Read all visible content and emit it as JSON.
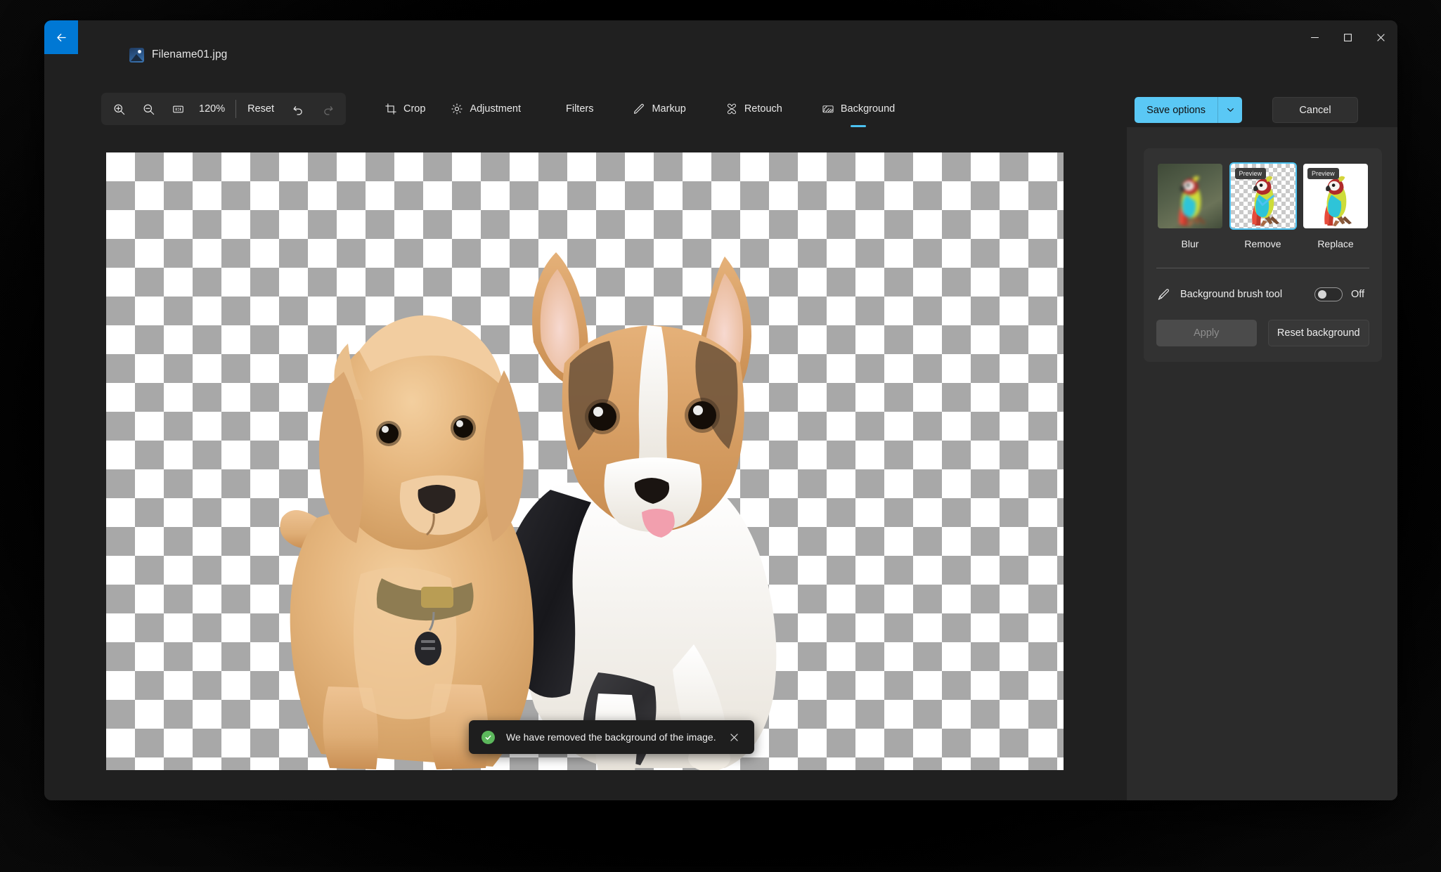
{
  "window": {
    "file_name": "Filename01.jpg",
    "back_icon": "arrow-left-icon",
    "file_icon": "photo-icon",
    "controls": {
      "minimize": "minimize-icon",
      "maximize": "maximize-icon",
      "close": "close-icon"
    }
  },
  "toolbar": {
    "zoom_in_icon": "zoom-in-icon",
    "zoom_out_icon": "zoom-out-icon",
    "actual_size_icon": "one-to-one-icon",
    "zoom_level": "120%",
    "reset_label": "Reset",
    "undo_icon": "undo-icon",
    "redo_icon": "redo-icon",
    "redo_disabled": true
  },
  "tabs": [
    {
      "label": "Crop",
      "icon": "crop-icon",
      "active": false
    },
    {
      "label": "Adjustment",
      "icon": "brightness-icon",
      "active": false
    },
    {
      "label": "Filters",
      "icon": "",
      "active": false
    },
    {
      "label": "Markup",
      "icon": "pen-icon",
      "active": false
    },
    {
      "label": "Retouch",
      "icon": "retouch-icon",
      "active": false
    },
    {
      "label": "Background",
      "icon": "background-icon",
      "active": true
    }
  ],
  "actions": {
    "save_options_label": "Save options",
    "save_options_chevron": "chevron-down-icon",
    "cancel_label": "Cancel"
  },
  "canvas": {
    "image_alt": "Two puppies on a transparent checkerboard background",
    "transparency_checker": true
  },
  "toast": {
    "icon": "success-check-icon",
    "message": "We have removed the background of the image.",
    "close_icon": "close-icon"
  },
  "panel": {
    "options": [
      {
        "label": "Blur",
        "style": "blur",
        "selected": false,
        "badge": ""
      },
      {
        "label": "Remove",
        "style": "checker",
        "selected": true,
        "badge": "Preview"
      },
      {
        "label": "Replace",
        "style": "white",
        "selected": false,
        "badge": "Preview"
      }
    ],
    "brush": {
      "icon": "brush-icon",
      "label": "Background brush tool",
      "state": "Off",
      "enabled": false
    },
    "apply_label": "Apply",
    "apply_disabled": true,
    "reset_background_label": "Reset background"
  },
  "colors": {
    "accent": "#4cc2f1",
    "save_button": "#5ac8f5",
    "back_button": "#0078d4",
    "success": "#5cb85c",
    "window_bg": "#202020",
    "panel_bg": "#2b2b2b",
    "card_bg": "#323232",
    "checker_gray": "#a8a8a8"
  }
}
